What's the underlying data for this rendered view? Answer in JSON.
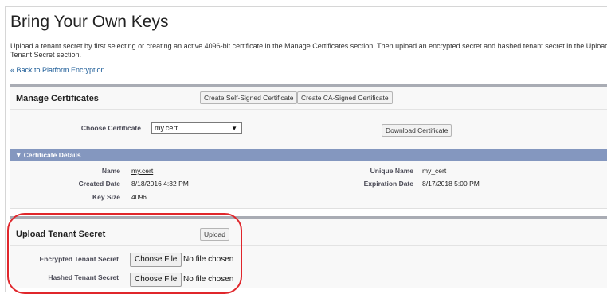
{
  "page": {
    "title": "Bring Your Own Keys",
    "description": "Upload a tenant secret by first selecting or creating an active 4096-bit certificate in the Manage Certificates section. Then upload an encrypted secret and hashed tenant secret in the Upload Tenant Secret section.",
    "back_link": "« Back to Platform Encryption"
  },
  "manage_certificates": {
    "title": "Manage Certificates",
    "create_self_signed_label": "Create Self-Signed Certificate",
    "create_ca_signed_label": "Create CA-Signed Certificate",
    "choose_certificate_label": "Choose Certificate",
    "choose_certificate_value": "my.cert",
    "download_label": "Download Certificate"
  },
  "certificate_details": {
    "header": "▼ Certificate Details",
    "name_label": "Name",
    "name_value": "my.cert",
    "unique_name_label": "Unique Name",
    "unique_name_value": "my_cert",
    "created_date_label": "Created Date",
    "created_date_value": "8/18/2016 4:32 PM",
    "expiration_date_label": "Expiration Date",
    "expiration_date_value": "8/17/2018 5:00 PM",
    "key_size_label": "Key Size",
    "key_size_value": "4096"
  },
  "upload_tenant_secret": {
    "title": "Upload Tenant Secret",
    "upload_label": "Upload",
    "encrypted_label": "Encrypted Tenant Secret",
    "hashed_label": "Hashed Tenant Secret",
    "choose_file_label": "Choose File",
    "no_file_text": "No file chosen"
  },
  "colors": {
    "details_bar": "#8497bf",
    "highlight": "#e0262b",
    "link": "#1a5a96"
  }
}
